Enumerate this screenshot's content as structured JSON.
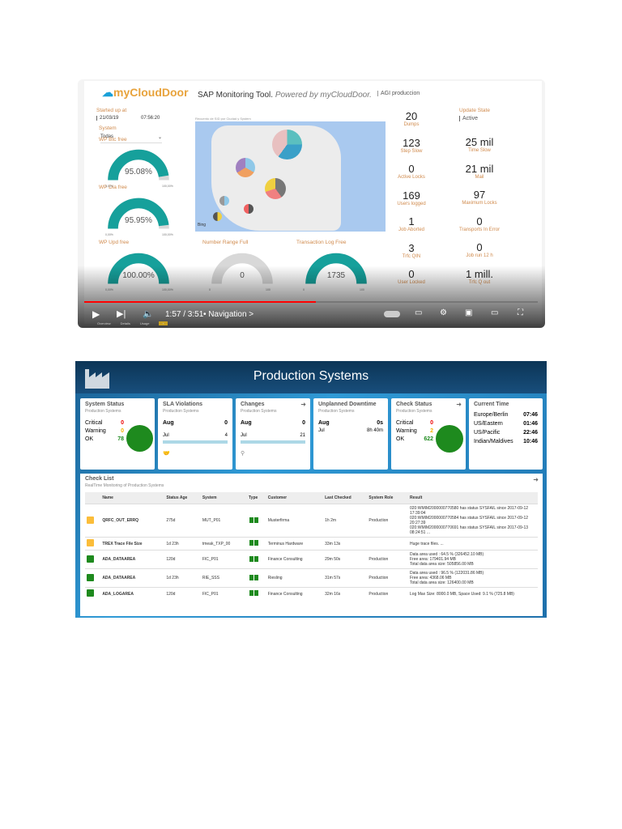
{
  "video": {
    "logo": "myCloudDoor",
    "title": "SAP Monitoring Tool.",
    "title_suffix": "Powered by myCloudDoor.",
    "system_name": "AGI produccion",
    "started_label": "Started up at",
    "started_date": "21/03/19",
    "started_time": "07:56:20",
    "system_label": "System",
    "system_value": "Todas",
    "map_title": "Recuento de SID por Ciudad y System",
    "map_brand": "Bing",
    "gauges": [
      {
        "label": "WP Btc free",
        "value": "95.08%",
        "level": 95.08,
        "min": "0,00%",
        "max": "100,00%"
      },
      {
        "label": "WP Dia free",
        "value": "95.95%",
        "level": 95.95,
        "min": "0,00%",
        "max": "100,00%"
      },
      {
        "label": "WP Upd free",
        "value": "100.00%",
        "level": 100,
        "min": "0,00%",
        "max": "100,00%"
      },
      {
        "label": "Number Range Full",
        "value": "0",
        "level": 0,
        "min": "0",
        "max": "100"
      },
      {
        "label": "Transaction Log Free",
        "value": "1735",
        "level": 100,
        "min": "0",
        "max": "100"
      }
    ],
    "kpis_left": [
      {
        "value": "20",
        "label": "Dumps"
      },
      {
        "value": "123",
        "label": "Step Slow"
      },
      {
        "value": "0",
        "label": "Active Locks"
      },
      {
        "value": "169",
        "label": "Users logged"
      },
      {
        "value": "1",
        "label": "Job Aborted"
      },
      {
        "value": "3",
        "label": "Trfc QIN"
      },
      {
        "value": "0",
        "label": "User Locked"
      }
    ],
    "update_label": "Update State",
    "update_value": "Active",
    "kpis_right": [
      {
        "value": "25 mil",
        "label": "Time Slow"
      },
      {
        "value": "21 mil",
        "label": "Mail"
      },
      {
        "value": "97",
        "label": "Maximum Locks"
      },
      {
        "value": "0",
        "label": "Transports In Error"
      },
      {
        "value": "0",
        "label": "Job run 12 h"
      },
      {
        "value": "1 mill.",
        "label": "Trfc Q out"
      }
    ],
    "time": "1:57 / 3:51",
    "chapter": "• Navigation >",
    "progress": 51,
    "page_tabs": [
      "Overview",
      "Details",
      "Usage",
      "+"
    ]
  },
  "prod": {
    "title": "Production Systems",
    "system_status": {
      "title": "System Status",
      "sub": "Production Systems",
      "critical": "0",
      "warning": "0",
      "ok": "78",
      "l_critical": "Critical",
      "l_warning": "Warning",
      "l_ok": "OK"
    },
    "sla": {
      "title": "SLA Violations",
      "sub": "Production Systems",
      "m1": "Aug",
      "v1": "0",
      "m2": "Jul",
      "v2": "4"
    },
    "changes": {
      "title": "Changes",
      "sub": "Production Systems",
      "m1": "Aug",
      "v1": "0",
      "m2": "Jul",
      "v2": "21"
    },
    "downtime": {
      "title": "Unplanned Downtime",
      "sub": "Production Systems",
      "m1": "Aug",
      "v1": "0s",
      "m2": "Jul",
      "v2": "8h 40m"
    },
    "check_status": {
      "title": "Check Status",
      "sub": "Production Systems",
      "critical": "0",
      "warning": "2",
      "ok": "622",
      "l_critical": "Critical",
      "l_warning": "Warning",
      "l_ok": "OK"
    },
    "current_time": {
      "title": "Current Time",
      "zones": [
        {
          "zone": "Europe/Berlin",
          "time": "07:46"
        },
        {
          "zone": "US/Eastern",
          "time": "01:46"
        },
        {
          "zone": "US/Pacific",
          "time": "22:46"
        },
        {
          "zone": "Indian/Maldives",
          "time": "10:46"
        }
      ]
    },
    "checklist": {
      "title": "Check List",
      "sub": "RealTime Monitoring of Production Systems",
      "columns": [
        "",
        "Name",
        "Status Age",
        "System",
        "Type",
        "Customer",
        "Last Checked",
        "System Role",
        "Result"
      ],
      "rows": [
        {
          "status": "#fbbd3a",
          "name": "QRFC_OUT_ERRQ",
          "age": "275d",
          "system": "MUT_P01",
          "customer": "Musterfirma",
          "checked": "1h 2m",
          "role": "Production",
          "result": [
            "020:WMIM2000000770580 has status SYSFAIL since 2017-09-12 17:39:04",
            "020:WMIM2000000770584 has status SYSFAIL since 2017-09-12 20:27:39",
            "020:WMIM2000000770691 has status SYSFAIL since 2017-09-13 08:24:51 ..."
          ]
        },
        {
          "status": "#fbbd3a",
          "name": "TREX Trace File Size",
          "age": "1d 23h",
          "system": "tmeak_TXP_00",
          "customer": "Terminus Hardware",
          "checked": "33m 13s",
          "role": "",
          "result": [
            "Huge trace files. ..."
          ]
        },
        {
          "status": "#1e8a1e",
          "name": "ADA_DATAAREA",
          "age": "120d",
          "system": "FIC_P01",
          "customer": "Finance Consulting",
          "checked": "29m 50s",
          "role": "Production",
          "result": [
            "Data area used : 64.5 % (326452.10 MB)",
            "Free area: 179401.94 MB",
            "Total data area size: 505856.00 MB"
          ]
        },
        {
          "status": "#1e8a1e",
          "name": "ADA_DATAAREA",
          "age": "1d 23h",
          "system": "RIE_SSS",
          "customer": "Riesling",
          "checked": "31m 57s",
          "role": "Production",
          "result": [
            "Data area used : 96.5 % (122031.86 MB)",
            "Free area: 4368.06 MB",
            "Total data area size: 126400.00 MB"
          ]
        },
        {
          "status": "#1e8a1e",
          "name": "ADA_LOGAREA",
          "age": "120d",
          "system": "FIC_P01",
          "customer": "Finance Consulting",
          "checked": "32m 16s",
          "role": "Production",
          "result": [
            "Log Max Size: 8000.0 MB, Space Used: 9.1 % (725.8 MB)"
          ]
        }
      ]
    }
  }
}
